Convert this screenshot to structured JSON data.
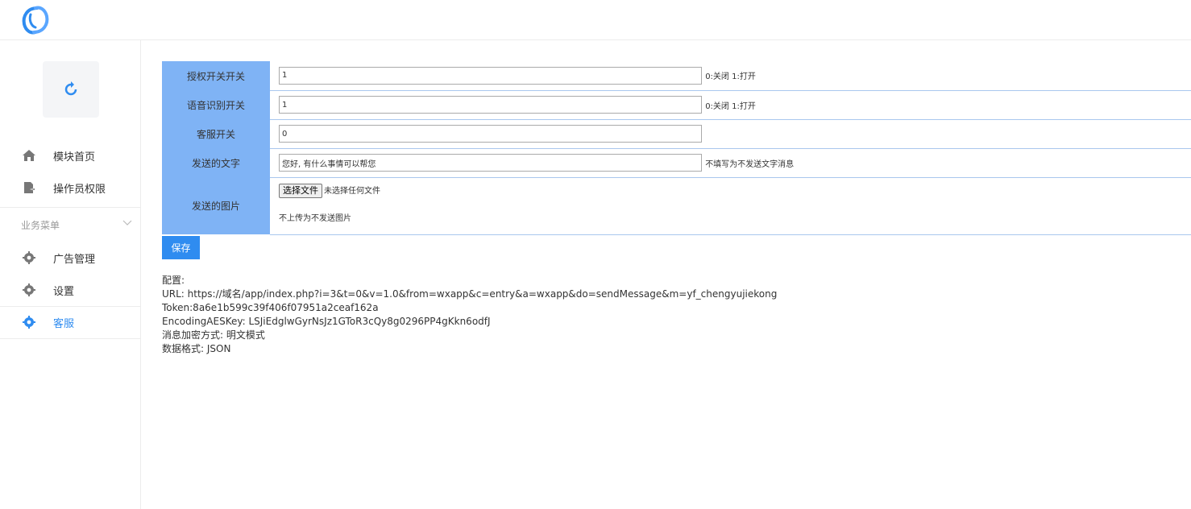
{
  "colors": {
    "accent": "#2f8cf0",
    "label_bg": "#7fb3f5",
    "icon_gray": "#777777"
  },
  "sidebar": {
    "items_top": [
      {
        "label": "模块首页",
        "icon": "home-icon"
      },
      {
        "label": "操作员权限",
        "icon": "document-icon"
      }
    ],
    "group": {
      "label": "业务菜单"
    },
    "items_business": [
      {
        "label": "广告管理",
        "icon": "gear-icon"
      },
      {
        "label": "设置",
        "icon": "gear-icon"
      },
      {
        "label": "客服",
        "icon": "gear-icon",
        "active": true
      }
    ]
  },
  "form": {
    "rows": [
      {
        "label": "授权开关开关",
        "value": "1",
        "hint": "0:关闭 1:打开"
      },
      {
        "label": "语音识别开关",
        "value": "1",
        "hint": "0:关闭 1:打开"
      },
      {
        "label": "客服开关",
        "value": "0",
        "hint": ""
      },
      {
        "label": "发送的文字",
        "value": "您好, 有什么事情可以帮您",
        "hint": "不填写为不发送文字消息"
      }
    ],
    "image_row": {
      "label": "发送的图片",
      "button": "选择文件",
      "no_file": "未选择任何文件",
      "hint": "不上传为不发送图片"
    },
    "save": "保存"
  },
  "config": {
    "title": "配置:",
    "lines": [
      "URL: https://域名/app/index.php?i=3&t=0&v=1.0&from=wxapp&c=entry&a=wxapp&do=sendMessage&m=yf_chengyujiekong",
      "Token:8a6e1b599c39f406f07951a2ceaf162a",
      "EncodingAESKey: LSJiEdglwGyrNsJz1GToR3cQy8g0296PP4gKkn6odfJ",
      "消息加密方式: 明文模式",
      "数据格式: JSON"
    ]
  }
}
